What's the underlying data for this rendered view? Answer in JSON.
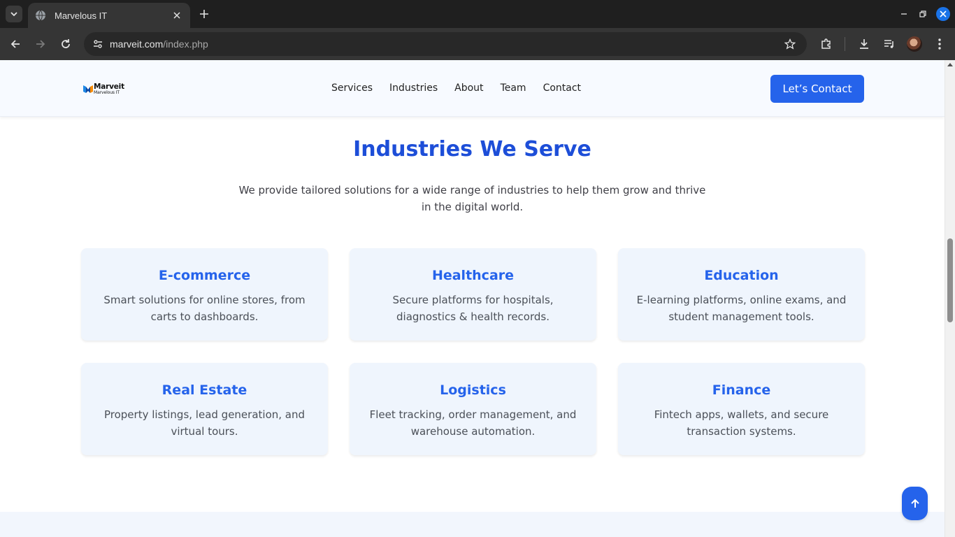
{
  "browser": {
    "tab_title": "Marvelous IT",
    "url_domain": "marveit.com",
    "url_path": "/index.php"
  },
  "header": {
    "logo_name": "Marveit",
    "logo_sub": "Marvelous IT",
    "nav": [
      "Services",
      "Industries",
      "About",
      "Team",
      "Contact"
    ],
    "cta_label": "Let’s Contact"
  },
  "section": {
    "title": "Industries We Serve",
    "subtitle": "We provide tailored solutions for a wide range of industries to help them grow and thrive in the digital world."
  },
  "industries": [
    {
      "title": "E-commerce",
      "desc": "Smart solutions for online stores, from carts to dashboards."
    },
    {
      "title": "Healthcare",
      "desc": "Secure platforms for hospitals, diagnostics & health records."
    },
    {
      "title": "Education",
      "desc": "E-learning platforms, online exams, and student management tools."
    },
    {
      "title": "Real Estate",
      "desc": "Property listings, lead generation, and virtual tours."
    },
    {
      "title": "Logistics",
      "desc": "Fleet tracking, order management, and warehouse automation."
    },
    {
      "title": "Finance",
      "desc": "Fintech apps, wallets, and secure transaction systems."
    }
  ],
  "colors": {
    "accent": "#2563eb",
    "heading": "#1d4ed8",
    "card_bg": "#eff5fd"
  },
  "icons": [
    "chevron-down-icon",
    "globe-icon",
    "close-icon",
    "plus-icon",
    "minimize-icon",
    "restore-icon",
    "back-icon",
    "forward-icon",
    "reload-icon",
    "site-settings-icon",
    "star-icon",
    "extensions-icon",
    "download-icon",
    "media-icon",
    "menu-icon",
    "arrow-up-icon"
  ]
}
